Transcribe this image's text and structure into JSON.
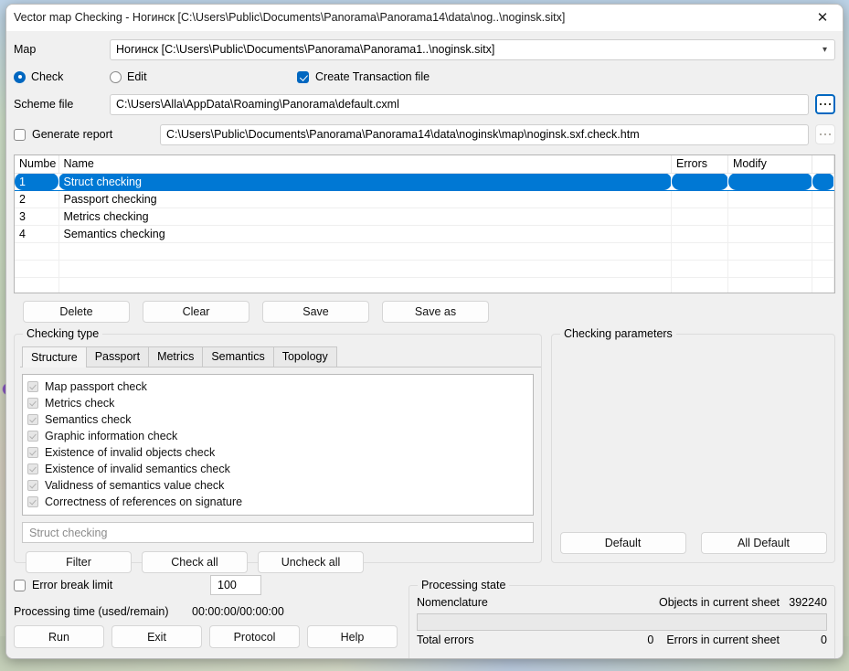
{
  "window": {
    "title": "Vector map Checking - Ногинск [C:\\Users\\Public\\Documents\\Panorama\\Panorama14\\data\\nog..\\noginsk.sitx]",
    "close_icon": "close-icon"
  },
  "form": {
    "map_label": "Map",
    "map_value": "Ногинск [C:\\Users\\Public\\Documents\\Panorama\\Panorama1..\\noginsk.sitx]",
    "chevron_icon": "▾",
    "check_label": "Check",
    "edit_label": "Edit",
    "transaction_label": "Create Transaction file",
    "scheme_label": "Scheme file",
    "scheme_value": "C:\\Users\\Alla\\AppData\\Roaming\\Panorama\\default.cxml",
    "generate_report_label": "Generate report",
    "report_value": "C:\\Users\\Public\\Documents\\Panorama\\Panorama14\\data\\noginsk\\map\\noginsk.sxf.check.htm"
  },
  "table": {
    "columns": [
      "Numbe",
      "Name",
      "Errors",
      "Modify"
    ],
    "rows": [
      {
        "number": "1",
        "name": "Struct checking",
        "errors": "",
        "modify": ""
      },
      {
        "number": "2",
        "name": "Passport checking",
        "errors": "",
        "modify": ""
      },
      {
        "number": "3",
        "name": "Metrics checking",
        "errors": "",
        "modify": ""
      },
      {
        "number": "4",
        "name": "Semantics checking",
        "errors": "",
        "modify": ""
      }
    ],
    "selected_index": 0,
    "selection_color": "#0078d4"
  },
  "list_actions": {
    "delete": "Delete",
    "clear": "Clear",
    "save": "Save",
    "save_as": "Save as"
  },
  "checking_type": {
    "legend": "Checking type",
    "tabs": [
      "Structure",
      "Passport",
      "Metrics",
      "Semantics",
      "Topology"
    ],
    "active_tab": "Structure",
    "items": [
      "Map passport check",
      "Metrics check",
      "Semantics check",
      "Graphic information check",
      "Existence of invalid objects check",
      "Existence of invalid semantics check",
      "Validness of semantics value check",
      "Correctness of references on signature"
    ],
    "name_field_value": "Struct checking",
    "filter": "Filter",
    "check_all": "Check all",
    "uncheck_all": "Uncheck all"
  },
  "checking_parameters": {
    "legend": "Checking parameters",
    "default": "Default",
    "all_default": "All Default"
  },
  "bottom": {
    "error_break_limit_label": "Error break limit",
    "error_break_limit_value": "100",
    "processing_time_label": "Processing time (used/remain)",
    "processing_time_value": "00:00:00/00:00:00",
    "run": "Run",
    "exit": "Exit",
    "protocol": "Protocol",
    "help": "Help"
  },
  "processing_state": {
    "legend": "Processing state",
    "nomenclature_label": "Nomenclature",
    "objects_label": "Objects in current sheet",
    "objects_value": "392240",
    "total_errors_label": "Total errors",
    "total_errors_value": "0",
    "sheet_errors_label": "Errors in current sheet",
    "sheet_errors_value": "0",
    "progress_percent": 0
  }
}
